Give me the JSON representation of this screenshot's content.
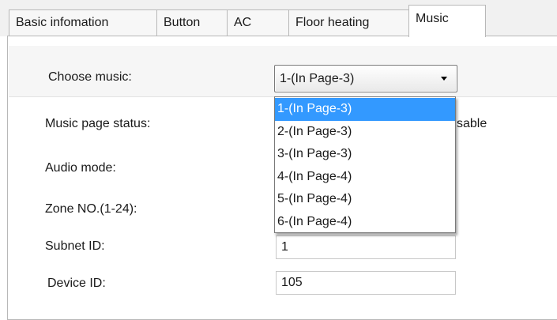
{
  "tabs": [
    {
      "label": "Basic infomation"
    },
    {
      "label": "Button"
    },
    {
      "label": "AC"
    },
    {
      "label": "Floor heating"
    },
    {
      "label": "Music"
    }
  ],
  "active_tab": "Music",
  "form": {
    "choose_music": {
      "label": "Choose music:",
      "value": "1-(In Page-3)"
    },
    "music_page_status": {
      "label": "Music page status:",
      "value_visible_fragment": "sable"
    },
    "audio_mode": {
      "label": "Audio mode:"
    },
    "zone_no": {
      "label": "Zone NO.(1-24):"
    },
    "subnet_id": {
      "label": "Subnet ID:",
      "value": "1"
    },
    "device_id": {
      "label": "Device ID:",
      "value": "105"
    }
  },
  "dropdown": {
    "options": [
      "1-(In Page-3)",
      "2-(In Page-3)",
      "3-(In Page-3)",
      "4-(In Page-4)",
      "5-(In Page-4)",
      "6-(In Page-4)"
    ],
    "highlighted_option": "1-(In Page-3)"
  },
  "colors": {
    "highlight": "#3399ff",
    "border": "#b8b8b8",
    "tabbar_background": "#f1f1f1"
  }
}
